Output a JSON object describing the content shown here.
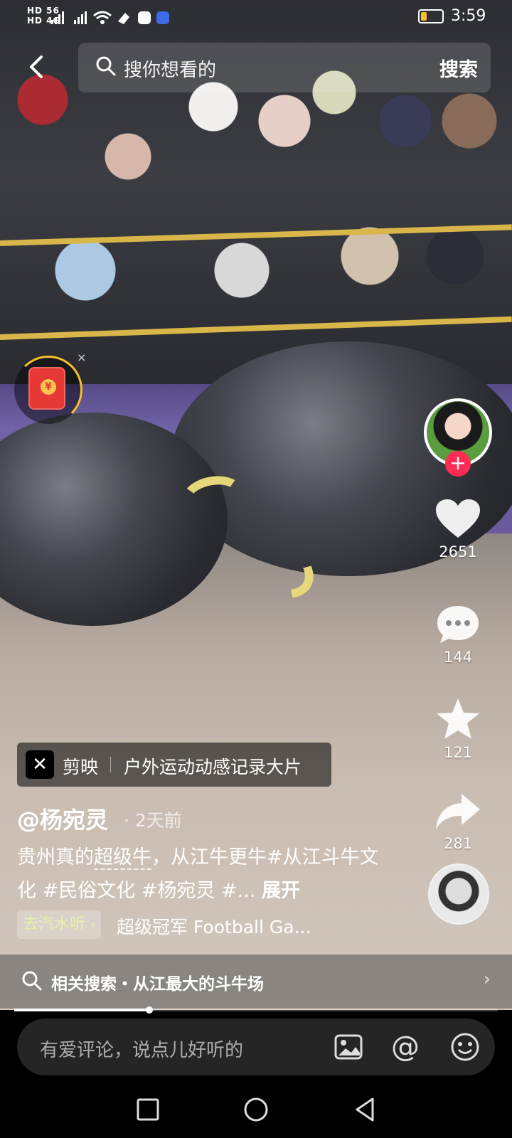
{
  "status_bar": {
    "network_1": "HD 56",
    "network_2": "HD 4G",
    "time": "3:59"
  },
  "top_search": {
    "back_icon": "chevron-left-icon",
    "placeholder": "搜你想看的",
    "search_button": "搜索"
  },
  "red_packet": {
    "icon": "red-envelope-icon",
    "coin_symbol": "¥",
    "close": "×"
  },
  "right_rail": {
    "follow_symbol": "+",
    "likes": "2651",
    "comments": "144",
    "favorites": "121",
    "shares": "281"
  },
  "template": {
    "app": "剪映",
    "text": "户外运动动感记录大片"
  },
  "post": {
    "author": "@杨宛灵",
    "time_ago": "· 2天前",
    "desc_part1": "贵州真的",
    "desc_link": "超级牛",
    "desc_part2": "，从江牛更牛#从江斗牛文化 #民俗文化 #杨宛灵 #... ",
    "expand": "展开",
    "music_tag": "去汽水听",
    "music_tag_chevron": "›",
    "song": "超级冠军 Football Ga..."
  },
  "related_search": {
    "label": "相关搜索・从江最大的斗牛场",
    "chevron": "›"
  },
  "video_progress": 0.28,
  "comment_bar": {
    "placeholder": "有爱评论，说点儿好听的",
    "at_symbol": "@"
  },
  "colors": {
    "follow_red": "#fe2c55",
    "tag_green": "#e4f2a8",
    "ring_yellow": "#f6c12a"
  }
}
